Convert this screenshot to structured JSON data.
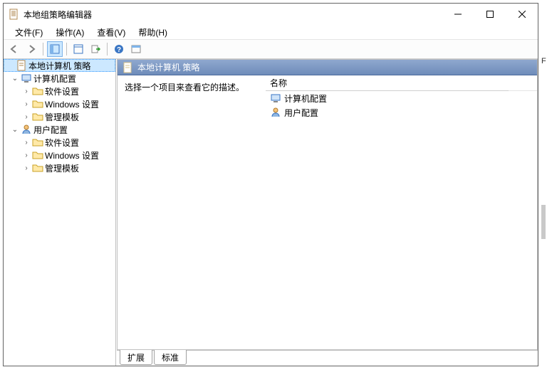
{
  "window": {
    "title": "本地组策略编辑器"
  },
  "menu": {
    "file": "文件(F)",
    "action": "操作(A)",
    "view": "查看(V)",
    "help": "帮助(H)"
  },
  "tree": {
    "root": "本地计算机 策略",
    "comp": "计算机配置",
    "comp_soft": "软件设置",
    "comp_win": "Windows 设置",
    "comp_adm": "管理模板",
    "user": "用户配置",
    "user_soft": "软件设置",
    "user_win": "Windows 设置",
    "user_adm": "管理模板"
  },
  "right": {
    "title": "本地计算机 策略",
    "hint": "选择一个项目来查看它的描述。",
    "col_name": "名称",
    "items": {
      "comp": "计算机配置",
      "user": "用户配置"
    }
  },
  "tabs": {
    "ext": "扩展",
    "std": "标准"
  }
}
